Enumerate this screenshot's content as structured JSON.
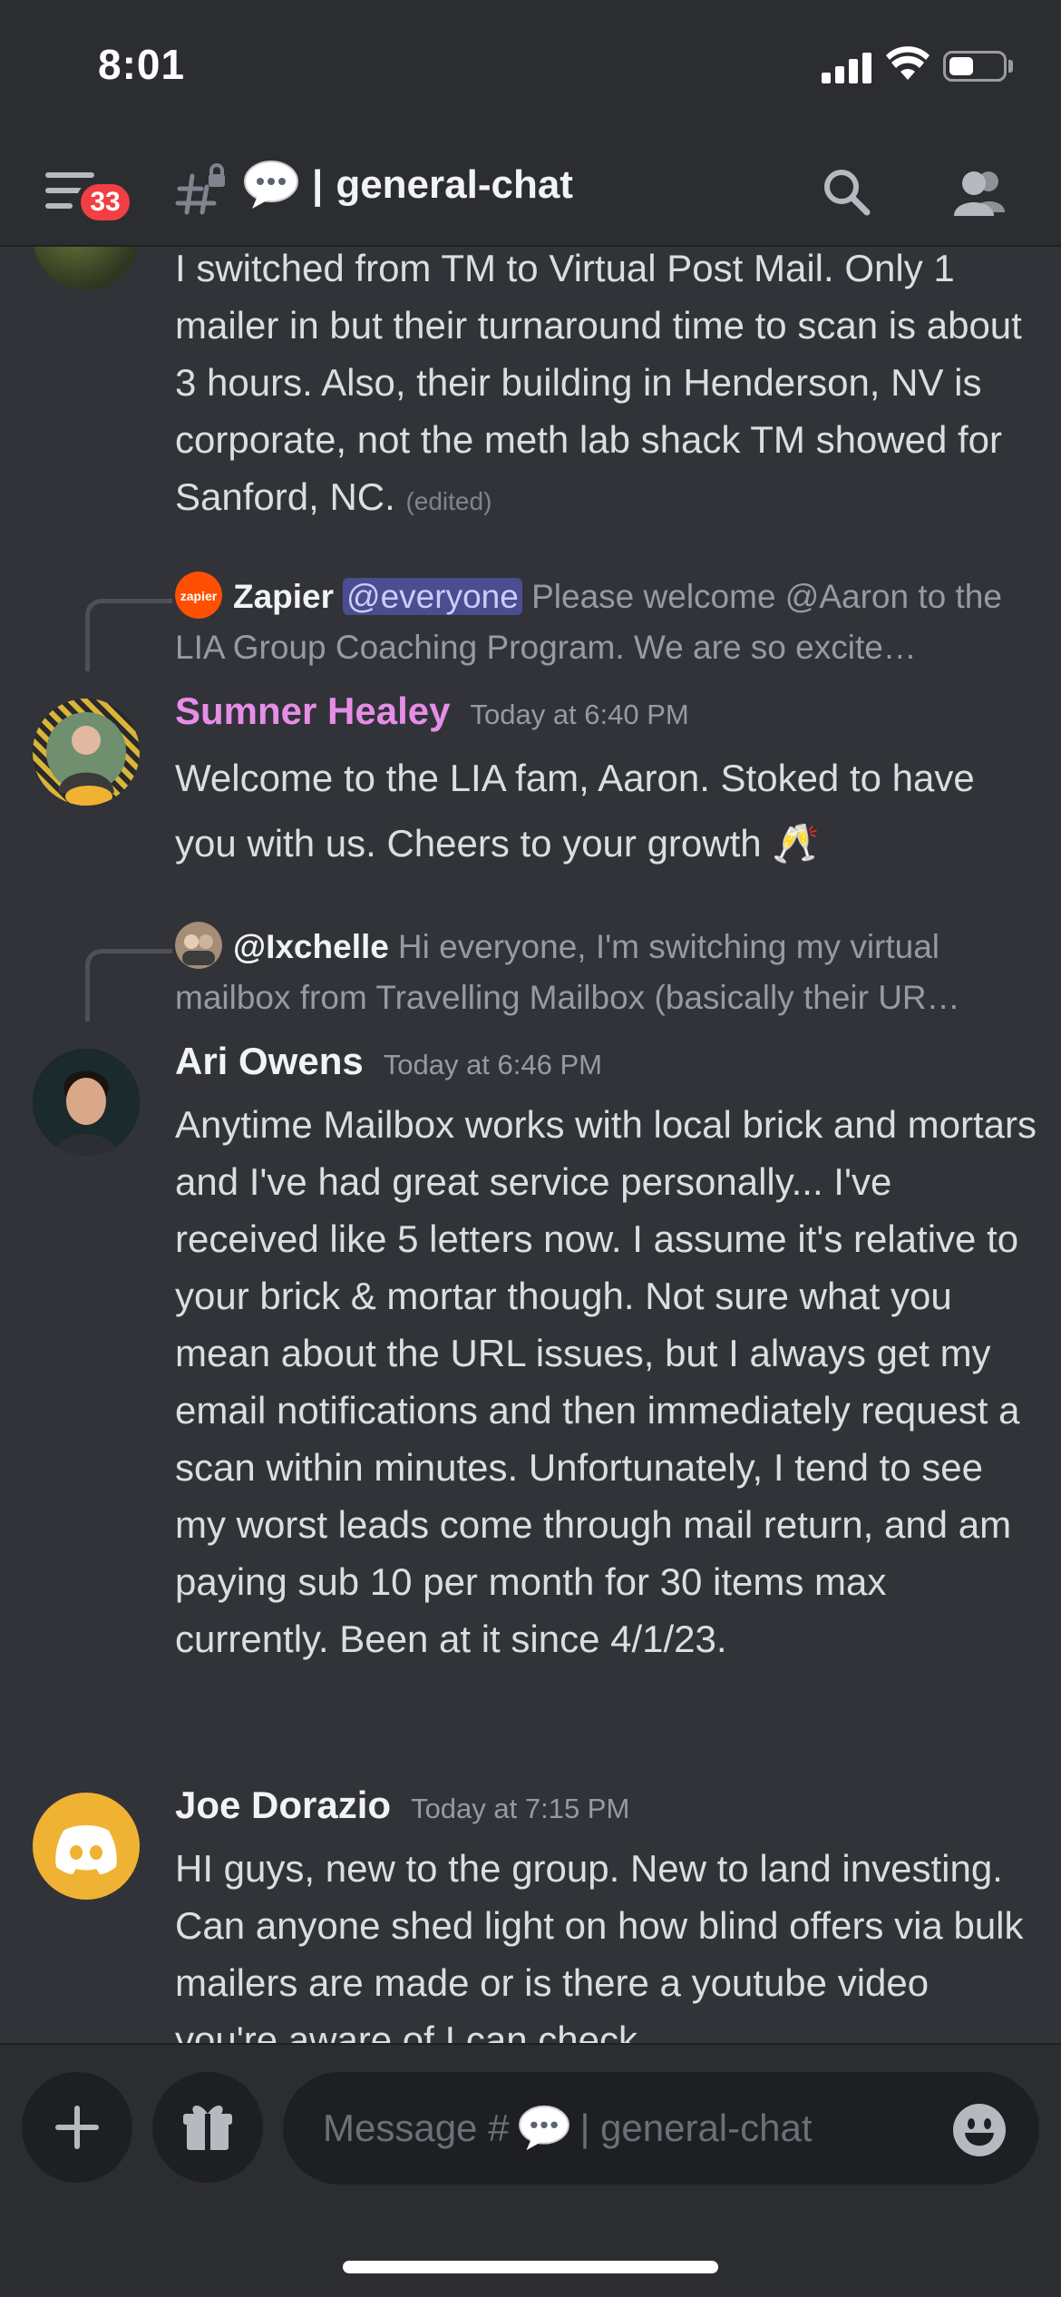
{
  "status_bar": {
    "time": "8:01"
  },
  "header": {
    "notification_count": "33",
    "channel_separator": "|",
    "channel_name": "general-chat"
  },
  "messages": [
    {
      "text": "I switched from TM to Virtual Post Mail. Only 1 mailer in but their turnaround time to scan is about 3 hours. Also, their building in Henderson, NV is corporate, not the meth lab shack TM showed for Sanford, NC.",
      "edited_label": "(edited)"
    },
    {
      "reply": {
        "avatar_label": "zapier",
        "name": "Zapier",
        "mention": "@everyone",
        "text": "Please welcome @Aaron to the LIA Group Coaching Program. We are so excite…"
      },
      "username": "Sumner Healey",
      "username_color": "#e78de8",
      "timestamp": "Today at 6:40 PM",
      "text": "Welcome to the LIA fam, Aaron. Stoked to have you with us. Cheers to your growth 🥂"
    },
    {
      "reply": {
        "name": "@Ixchelle",
        "text": "Hi everyone, I'm switching my virtual mailbox from Travelling Mailbox (basically their UR…"
      },
      "username": "Ari Owens",
      "username_color": "#f2f3f5",
      "timestamp": "Today at 6:46 PM",
      "text": "Anytime Mailbox works with local brick and mortars and I've had great service personally... I've received like 5 letters now. I assume it's relative to your brick & mortar though. Not sure what you mean about the URL issues, but I always get my email notifications and then immediately request a scan within minutes. Unfortunately, I tend to see my worst leads come through mail return, and am paying sub 10 per month for 30 items max currently. Been at it since 4/1/23."
    },
    {
      "username": "Joe Dorazio",
      "username_color": "#f2f3f5",
      "timestamp": "Today at 7:15 PM",
      "text": "HI guys, new to the group. New to land investing.  Can anyone shed light on how blind offers via bulk mailers are made or is there a youtube video you're aware of I can check"
    }
  ],
  "composer": {
    "placeholder_prefix": "Message #",
    "placeholder_channel": "| general-chat"
  },
  "colors": {
    "background": "#313338",
    "header_bg": "#2b2d31",
    "badge": "#f23f43",
    "mention_bg": "#4a4d8f",
    "discord_avatar": "#f0b232"
  }
}
